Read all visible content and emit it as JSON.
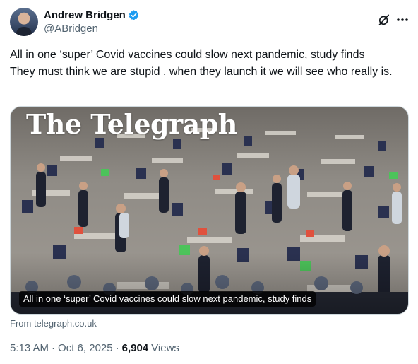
{
  "author": {
    "display_name": "Andrew Bridgen",
    "handle": "@ABridgen",
    "verified": true,
    "verified_color": "#1d9bf0",
    "avatar_icon": "profile-photo"
  },
  "header_icons": {
    "grok": "grok-icon",
    "more": "more-icon"
  },
  "tweet": {
    "text": "All in one ‘super’ Covid vaccines could slow next pandemic, study finds\nThey must think we are stupid , when they launch it we will see who really is."
  },
  "media": {
    "masthead": "The Telegraph",
    "headline": "All in one ‘super’ Covid vaccines could slow next pandemic, study finds",
    "source": "From telegraph.co.uk"
  },
  "meta": {
    "time": "5:13 AM",
    "date": "Oct 6, 2025",
    "separator": "·",
    "views_count": "6,904",
    "views_label": "Views"
  },
  "colors": {
    "text_primary": "#0f1419",
    "text_secondary": "#536471",
    "border": "#cfd9de"
  }
}
